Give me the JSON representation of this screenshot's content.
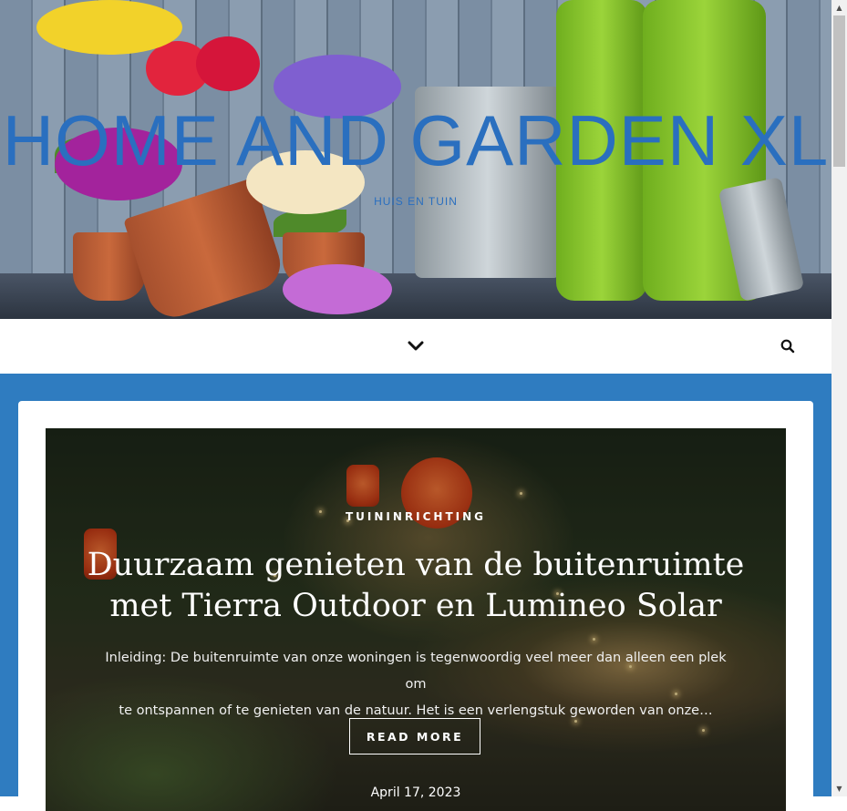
{
  "header": {
    "site_title": "HOME AND GARDEN XL",
    "tagline": "HUIS EN TUIN"
  },
  "nav": {
    "menu_toggle_icon": "chevron-down-icon",
    "search_icon": "search-icon"
  },
  "featured_post": {
    "category": "TUININRICHTING",
    "title_line1": "Duurzaam genieten van de buitenruimte",
    "title_line2": "met Tierra Outdoor en Lumineo Solar",
    "excerpt_line1": "Inleiding: De buitenruimte van onze woningen is tegenwoordig veel meer dan alleen een plek om",
    "excerpt_line2": "te ontspannen of te genieten van de natuur. Het is een verlengstuk geworden van onze…",
    "read_more_label": "READ MORE",
    "date": "April 17, 2023"
  },
  "colors": {
    "accent_blue": "#2f7cc0",
    "title_blue": "#2a6fbf"
  }
}
